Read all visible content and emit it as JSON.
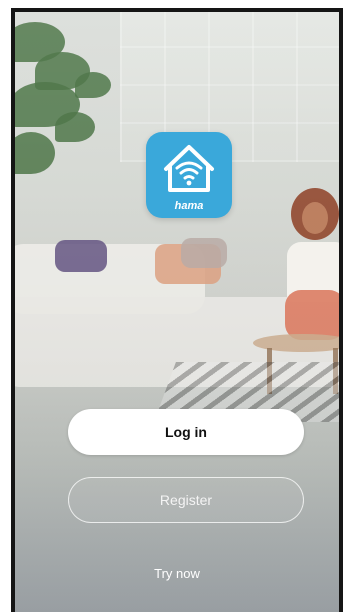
{
  "app": {
    "brand": "hama",
    "icon": "wifi-home-icon",
    "accent_color": "#3aa8da"
  },
  "actions": {
    "login_label": "Log in",
    "register_label": "Register",
    "try_now_label": "Try now"
  }
}
